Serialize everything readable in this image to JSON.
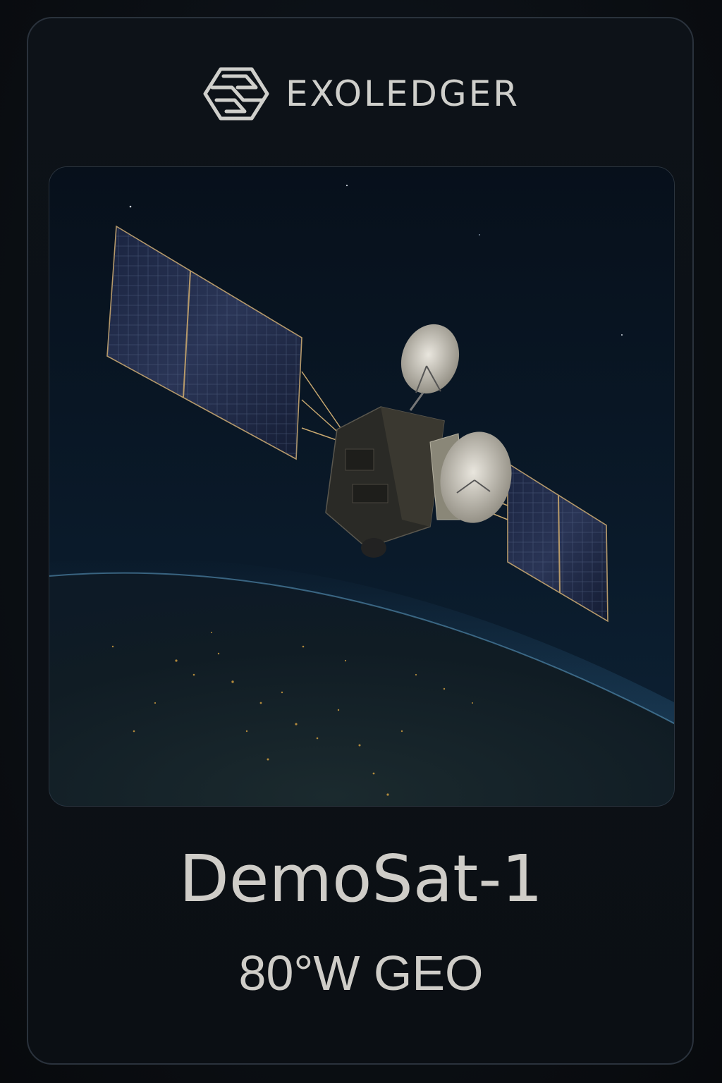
{
  "brand": {
    "name": "EXOLEDGER",
    "logo_icon": "hexagon-logo-icon"
  },
  "hero_image": {
    "description_icon": "satellite-over-earth-image"
  },
  "satellite": {
    "name": "DemoSat-1",
    "orbit": "80°W GEO"
  },
  "colors": {
    "background": "#0b0f14",
    "card_border": "#2a323c",
    "text": "#cfcdc8",
    "earth_glow": "#3b7aa8",
    "city_lights": "#d9a441"
  }
}
